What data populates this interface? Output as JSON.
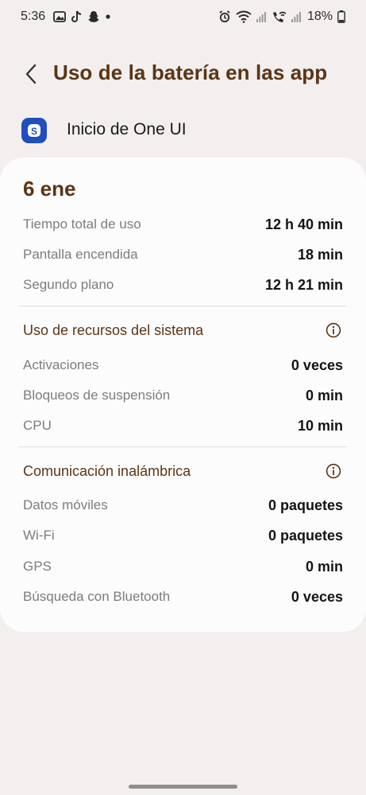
{
  "status_bar": {
    "time": "5:36",
    "battery_pct": "18%",
    "icons": [
      "image-icon",
      "tiktok-icon",
      "snapchat-icon",
      "dot-icon",
      "alarm-icon",
      "wifi-icon",
      "signal-icon",
      "wifi-call-icon",
      "signal-icon",
      "battery-icon"
    ]
  },
  "header": {
    "title": "Uso de la batería en las app",
    "back_icon": "chevron-left-icon"
  },
  "app": {
    "name": "Inicio de One UI",
    "icon_letter": "S",
    "icon_color": "#1f4fbf"
  },
  "card": {
    "date": "6 ene",
    "usage": [
      {
        "label": "Tiempo total de uso",
        "value": "12 h 40 min"
      },
      {
        "label": "Pantalla encendida",
        "value": "18 min"
      },
      {
        "label": "Segundo plano",
        "value": "12 h 21 min"
      }
    ],
    "system": {
      "title": "Uso de recursos del sistema",
      "rows": [
        {
          "label": "Activaciones",
          "value": "0 veces"
        },
        {
          "label": "Bloqueos de suspensión",
          "value": "0 min"
        },
        {
          "label": "CPU",
          "value": "10 min"
        }
      ]
    },
    "wireless": {
      "title": "Comunicación inalámbrica",
      "rows": [
        {
          "label": "Datos móviles",
          "value": "0 paquetes"
        },
        {
          "label": "Wi-Fi",
          "value": "0 paquetes"
        },
        {
          "label": "GPS",
          "value": "0 min"
        },
        {
          "label": "Búsqueda con Bluetooth",
          "value": "0 veces"
        }
      ]
    }
  },
  "colors": {
    "accent_brown": "#5b3515",
    "background": "#f3efee",
    "card": "#fcfcfc"
  }
}
